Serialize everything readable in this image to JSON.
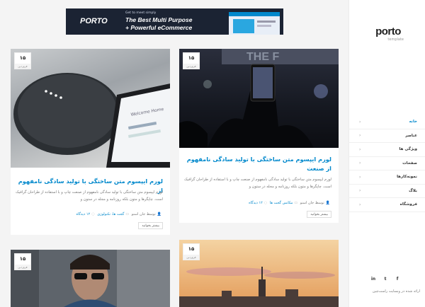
{
  "banner": {
    "brand": "PORTO",
    "tagline_small": "Get to meet simply",
    "line1": "The Best Multi Purpose",
    "line2": "+ Powerful eCommerce"
  },
  "sidebar": {
    "logo": "porto",
    "logo_sub": "template",
    "nav": [
      {
        "label": "خانه",
        "active": true
      },
      {
        "label": "عناصر",
        "active": false
      },
      {
        "label": "ویژگی ها",
        "active": false
      },
      {
        "label": "صفحات",
        "active": false
      },
      {
        "label": "نمونه‌کارها",
        "active": false
      },
      {
        "label": "بلاگ",
        "active": false
      },
      {
        "label": "فروشگاه",
        "active": false
      }
    ],
    "social": [
      "f",
      "t",
      "in"
    ],
    "copyright": "ارائه شده در وبسایت راست‌چین"
  },
  "posts": [
    {
      "day": "۱۵",
      "month": "فروردین",
      "title": "لورم ایپسوم متن ساختگی با تولید سادگی نامفهوم از صنعت",
      "excerpt": "لورم ایپسوم متن ساختگی با تولید سادگی نامفهوم از صنعت چاپ و با استفاده از طراحان گرافیک است. چاپگرها و متون بلکه روزنامه و مجله در ستون و",
      "author": "توسط جان اسنو",
      "category": "مکانس گجت ها",
      "comments": "۱۲ دیدگاه",
      "more": "بیشتر بخوانید"
    },
    {
      "day": "۱۵",
      "month": "فروردین",
      "title": "لورم ایپسوم متن ساختگی با تولید سادگی نامفهوم از",
      "excerpt": "لورم ایپسوم متن ساختگی با تولید سادگی نامفهوم از صنعت چاپ و با استفاده از طراحان گرافیک است. چاپگرها و متون بلکه روزنامه و مجله در ستون و",
      "author": "توسط جان اسنو",
      "category": "گجت ها، تکنولوژی",
      "comments": "۱۲ دیدگاه",
      "more": "بیشتر بخوانید"
    },
    {
      "day": "۱۵",
      "month": "فروردین"
    },
    {
      "day": "۱۵",
      "month": "فروردین"
    }
  ],
  "colors": {
    "accent": "#0088cc"
  }
}
